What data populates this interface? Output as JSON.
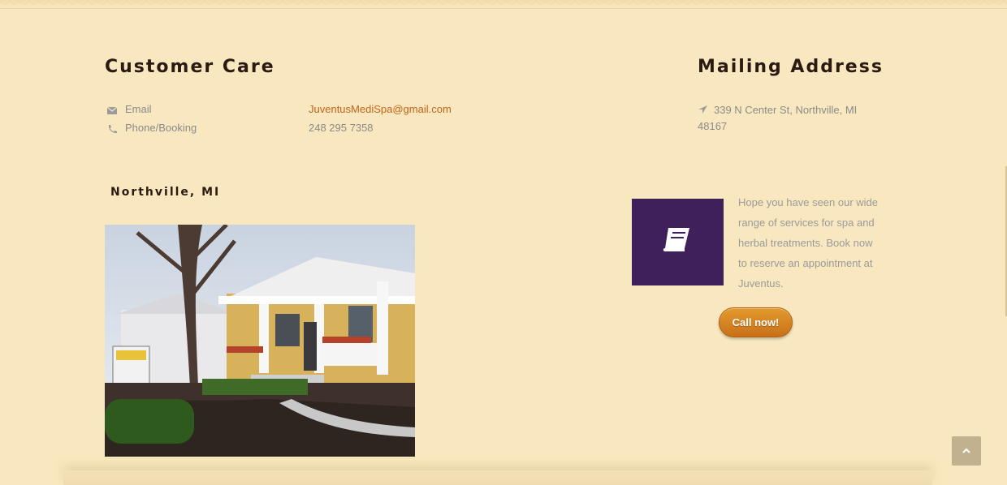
{
  "customer_care": {
    "title": "Customer Care",
    "email_label": "Email",
    "email_value": "JuventusMediSpa@gmail.com",
    "phone_label": "Phone/Booking",
    "phone_value": "248 295 7358"
  },
  "mailing": {
    "title": "Mailing Address",
    "address": "339 N Center St, Northville, MI 48167"
  },
  "location": {
    "subtitle": "Northville, MI"
  },
  "promo": {
    "text": "Hope you have seen our wide range of services for spa and herbal treatments. Book now to reserve an appointment at Juventus.",
    "button_label": "Call now!",
    "icon": "book-icon",
    "accent_color": "#40205a"
  },
  "colors": {
    "background": "#f9e8bf",
    "link": "#c0631c",
    "button": "#d9841f"
  },
  "icons": {
    "email": "envelope-icon",
    "phone": "phone-icon",
    "address": "location-arrow-icon",
    "back_to_top": "chevron-up-icon"
  }
}
